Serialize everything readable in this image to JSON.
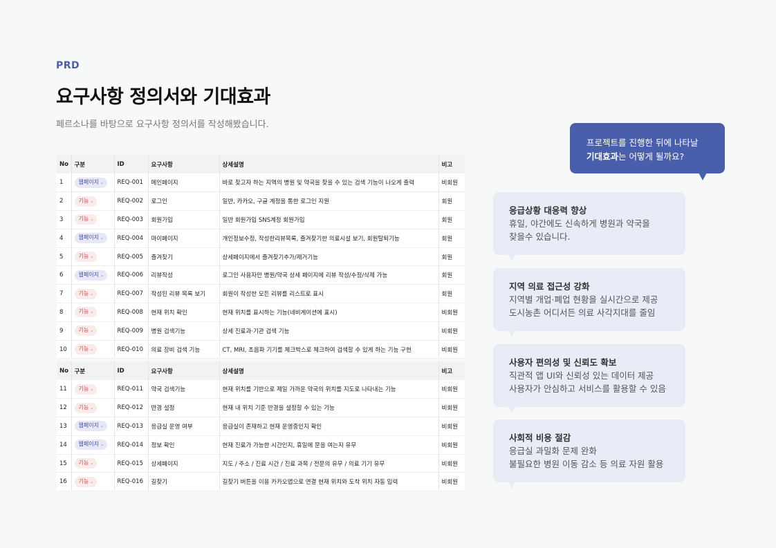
{
  "header": {
    "eyebrow": "PRD",
    "title": "요구사항 정의서와 기대효과",
    "subtitle": "페르소나를 바탕으로 요구사항 정의서를 작성해봤습니다."
  },
  "table": {
    "columns": [
      "No",
      "구분",
      "ID",
      "요구사항",
      "상세설명",
      "비고"
    ],
    "groups": [
      [
        {
          "no": "1",
          "type": "웹페이지",
          "kind": "web",
          "id": "REQ-001",
          "req": "메인페이지",
          "desc": "바로 찾고자 하는 지역의 병원 및 약국을 찾을 수 있는 검색 기능이 나오게 출력",
          "note": "비회원"
        },
        {
          "no": "2",
          "type": "기능",
          "kind": "func",
          "id": "REQ-002",
          "req": "로그인",
          "desc": "일반, 카카오, 구글 계정을 통한 로그인 지원",
          "note": "회원"
        },
        {
          "no": "3",
          "type": "기능",
          "kind": "func",
          "id": "REQ-003",
          "req": "회원가입",
          "desc": "일반 회원가입 SNS계정 회원가입",
          "note": "회원"
        },
        {
          "no": "4",
          "type": "웹페이지",
          "kind": "web",
          "id": "REQ-004",
          "req": "마이페이지",
          "desc": "개인정보수정, 작성한리뷰목록, 즐겨찾기한 의료시설 보기, 회원탈퇴기능",
          "note": "회원"
        },
        {
          "no": "5",
          "type": "기능",
          "kind": "func",
          "id": "REQ-005",
          "req": "즐겨찾기",
          "desc": "상세페이지에서 즐겨찾기추가/제거기능",
          "note": "회원"
        },
        {
          "no": "6",
          "type": "웹페이지",
          "kind": "web",
          "id": "REQ-006",
          "req": "리뷰작성",
          "desc": "로그인 사용자만 병원/약국 상세 페이지에 리뷰 작성/수정/삭제 가능",
          "note": "회원"
        },
        {
          "no": "7",
          "type": "기능",
          "kind": "func",
          "id": "REQ-007",
          "req": "작성된 리뷰 목록 보기",
          "desc": "회원이 작성한 모든 리뷰를 리스트로 표시",
          "note": "회원"
        },
        {
          "no": "8",
          "type": "기능",
          "kind": "func",
          "id": "REQ-008",
          "req": "현재 위치 확인",
          "desc": "현재 위치를 표시하는 기능(네비게이션에 표시)",
          "note": "비회원"
        },
        {
          "no": "9",
          "type": "기능",
          "kind": "func",
          "id": "REQ-009",
          "req": "병원 검색기능",
          "desc": "상세 진료과·기관 검색 기능",
          "note": "비회원"
        },
        {
          "no": "10",
          "type": "기능",
          "kind": "func",
          "id": "REQ-010",
          "req": "의료 장비 검색 기능",
          "desc": "CT, MRI, 초음파 기기를 체크박스로 체크하여 검색할 수 있게 하는 기능 구현",
          "note": "비회원"
        }
      ],
      [
        {
          "no": "11",
          "type": "기능",
          "kind": "func",
          "id": "REQ-011",
          "req": "약국 검색기능",
          "desc": "현재 위치를 기반으로 제일 가까운 약국의 위치를 지도로 나타내는 기능",
          "note": "비회원"
        },
        {
          "no": "12",
          "type": "기능",
          "kind": "func",
          "id": "REQ-012",
          "req": "반경 설정",
          "desc": "현재 내 위치 기준 반경을 설정할 수 있는 기능",
          "note": "비회원"
        },
        {
          "no": "13",
          "type": "웹페이지",
          "kind": "web",
          "id": "REQ-013",
          "req": "응급실 운영 여부",
          "desc": "응급실이 존재하고 현재 운영중인지 확인",
          "note": "비회원"
        },
        {
          "no": "14",
          "type": "웹페이지",
          "kind": "web",
          "id": "REQ-014",
          "req": "정보 확인",
          "desc": "현재 진료가 가능한 시간인지, 휴일에 문을 여는지 유무",
          "note": "비회원"
        },
        {
          "no": "15",
          "type": "기능",
          "kind": "func",
          "id": "REQ-015",
          "req": "상세페이지",
          "desc": "지도 / 주소 / 진료 시간 / 진료 과목 / 전문의 유무 / 의료 기기 유무",
          "note": "비회원"
        },
        {
          "no": "16",
          "type": "기능",
          "kind": "func",
          "id": "REQ-016",
          "req": "길찾기",
          "desc": "길찾기 버튼을 이용 카카오맵으로 연결 현재 위치와 도착 위치 자동 입력",
          "note": "비회원"
        }
      ]
    ]
  },
  "question": {
    "line1": "프로젝트를 진행한 뒤에 나타날",
    "bold": "기대효과",
    "rest": "는 어떻게 될까요?"
  },
  "effects": [
    {
      "title": "응급상황 대응력 향상",
      "line1": "휴일, 야간에도 신속하게 병원과 약국을",
      "line2": "찾을수 있습니다."
    },
    {
      "title": "지역 의료 접근성 강화",
      "line1": "지역별 개업·폐업 현황을 실시간으로 제공",
      "line2": "도시농촌 어디서든 의료 사각지대를 줄임"
    },
    {
      "title": "사용자 편의성 및 신뢰도 확보",
      "line1": "직관적 앱 UI와 신뢰성 있는 데이터 제공",
      "line2": "사용자가 안심하고 서비스를 활용할 수 있음"
    },
    {
      "title": "사회적 비용 절감",
      "line1": "응급실 과밀화 문제 완화",
      "line2": "불필요한 병원 이동 감소 등 의료 자원 활용"
    }
  ],
  "colors": {
    "accent": "#4a5fab",
    "card_bg": "#e8ecf6",
    "web_tag": "#4a55a8",
    "func_tag": "#d55050"
  }
}
